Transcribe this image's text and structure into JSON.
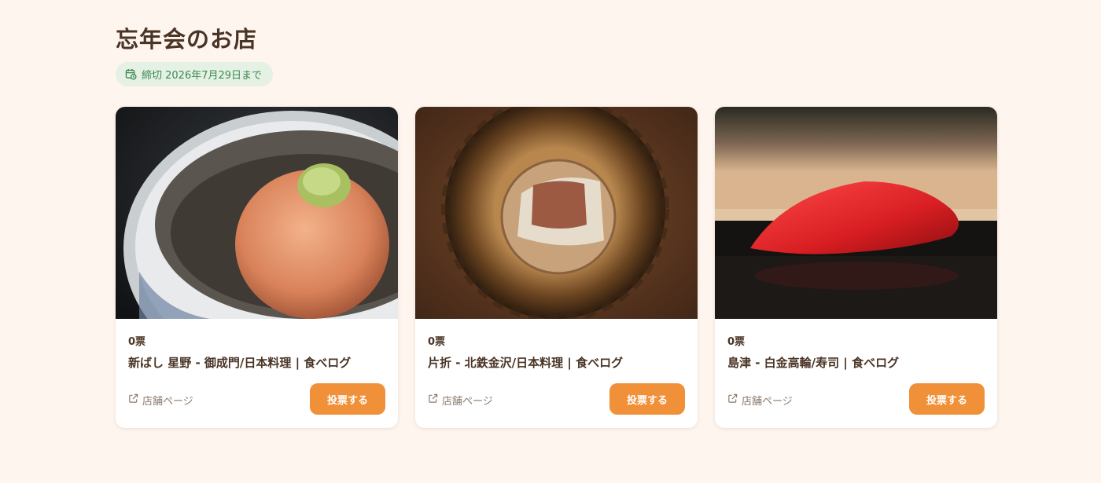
{
  "page": {
    "title": "忘年会のお店"
  },
  "deadline": {
    "text": "締切 2026年7月29日まで",
    "icon": "calendar-clock-icon"
  },
  "colors": {
    "accent": "#f0913a",
    "background": "#fdf5ee",
    "badge_bg": "#e4f1e4",
    "badge_text": "#3d8a52"
  },
  "cards": [
    {
      "votes": "0票",
      "name": "新ばし 星野 - 御成門/日本料理 | 食べログ",
      "link_label": "店舗ページ",
      "vote_label": "投票する",
      "photo": "tempura-in-dashi-bowl"
    },
    {
      "votes": "0票",
      "name": "片折 - 北鉄金沢/日本料理 | 食べログ",
      "link_label": "店舗ページ",
      "vote_label": "投票する",
      "photo": "grilled-fish-on-ceramic-plate"
    },
    {
      "votes": "0票",
      "name": "島津 - 白金高輪/寿司 | 食べログ",
      "link_label": "店舗ページ",
      "vote_label": "投票する",
      "photo": "tuna-nigiri-sushi"
    }
  ]
}
